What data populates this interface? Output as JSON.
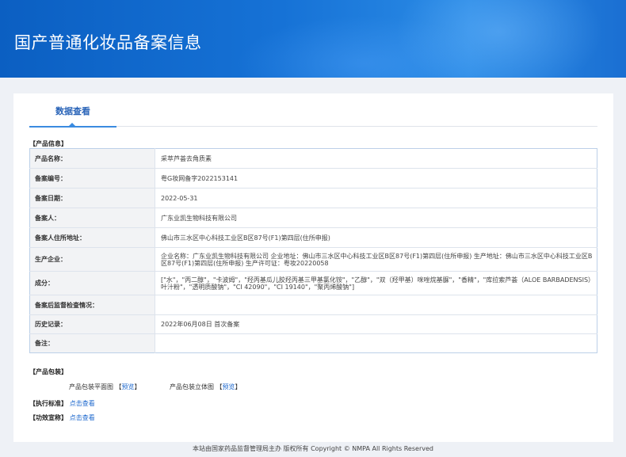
{
  "header": {
    "title": "国产普通化妆品备案信息"
  },
  "tabs": [
    {
      "label": "数据查看"
    }
  ],
  "product_info": {
    "section_label": "【产品信息】",
    "rows": [
      {
        "label": "产品名称：",
        "value": "采萃芦荟去角质素"
      },
      {
        "label": "备案编号：",
        "value": "粤G妆网备字2022153141"
      },
      {
        "label": "备案日期：",
        "value": "2022-05-31"
      },
      {
        "label": "备案人：",
        "value": "广东业凯生物科技有限公司"
      },
      {
        "label": "备案人住所地址：",
        "value": "佛山市三水区中心科技工业区B区87号(F1)第四层(住所申报)"
      },
      {
        "label": "生产企业：",
        "value": "企业名称：广东业凯生物科技有限公司 企业地址：佛山市三水区中心科技工业区B区87号(F1)第四层(住所申报) 生产地址：佛山市三水区中心科技工业区B区87号(F1)第四层(住所申报) 生产许可证：粤妆20220058"
      },
      {
        "label": "成分：",
        "value": "[\"水\"，\"丙二醇\"，\"卡波姆\"，\"羟丙基瓜儿胶羟丙基三甲基氯化铵\"，\"乙醇\"，\"双（羟甲基）咪唑烷基脲\"，\"香精\"，\"库拉索芦荟（ALOE BARBADENSIS）叶汁粉\"，\"透明质酸钠\"，\"CI 42090\"，\"CI 19140\"，\"聚丙烯酸钠\"]"
      },
      {
        "label": "备案后监督检查情况：",
        "value": ""
      },
      {
        "label": "历史记录：",
        "value": "2022年06月08日 首次备案"
      },
      {
        "label": "备注：",
        "value": ""
      }
    ]
  },
  "packaging": {
    "section_label": "【产品包装】",
    "flat_label": "产品包装平面图",
    "flat_link": "预览",
    "solid_label": "产品包装立体图",
    "solid_link": "预览",
    "bracket_open": "【",
    "bracket_close": "】"
  },
  "standard": {
    "label": "【执行标准】",
    "link": "点击查看"
  },
  "efficacy": {
    "label": "【功效宣称】",
    "link": "点击查看"
  },
  "footer": {
    "text": "本站由国家药品监督管理局主办 版权所有 Copyright © NMPA All Rights Reserved"
  }
}
